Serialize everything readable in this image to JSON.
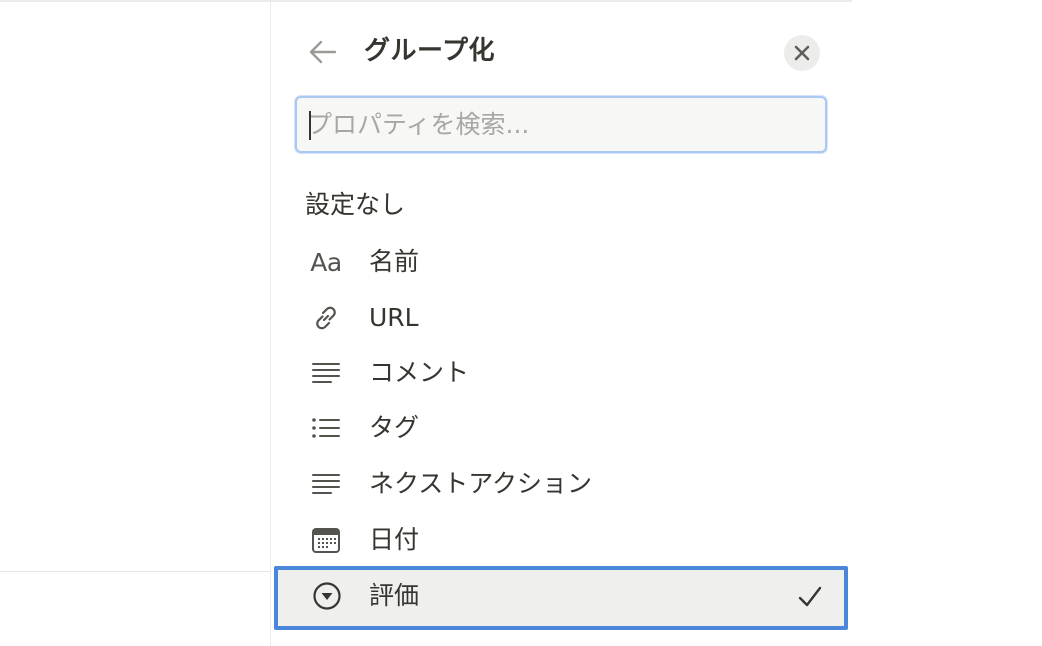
{
  "header": {
    "title": "グループ化",
    "back_icon": "arrow-left-icon",
    "close_icon": "close-icon"
  },
  "search": {
    "placeholder": "プロパティを検索...",
    "value": ""
  },
  "no_setting_label": "設定なし",
  "properties": [
    {
      "icon": "text-aa-icon",
      "icon_text": "Aa",
      "label": "名前"
    },
    {
      "icon": "link-icon",
      "label": "URL"
    },
    {
      "icon": "lines-icon",
      "label": "コメント"
    },
    {
      "icon": "bullet-list-icon",
      "label": "タグ"
    },
    {
      "icon": "lines-icon",
      "label": "ネクストアクション"
    },
    {
      "icon": "calendar-icon",
      "label": "日付"
    },
    {
      "icon": "select-dropdown-icon",
      "label": "評価",
      "selected": true
    }
  ],
  "colors": {
    "selection_border": "#4a86d9",
    "search_focus": "#a9c8f2",
    "text": "#37352f",
    "icon": "#55534e"
  }
}
